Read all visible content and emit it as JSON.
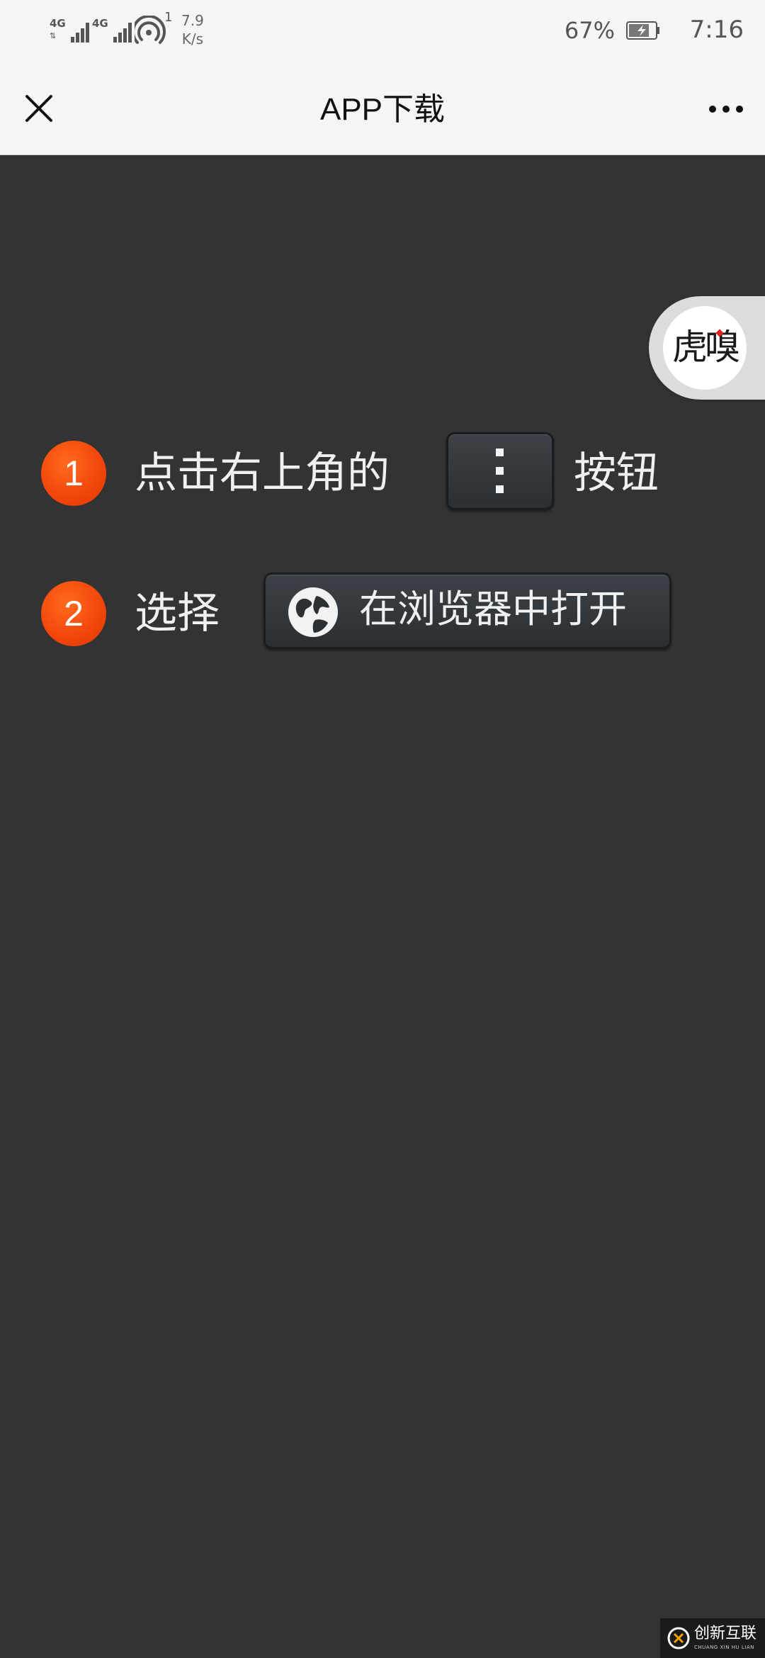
{
  "status_bar": {
    "network_1": "4G",
    "network_2": "4G",
    "hotspot_count": "1",
    "speed_value": "7.9",
    "speed_unit": "K/s",
    "battery_percent": "67%",
    "time": "7:16",
    "icons": [
      "signal-icon",
      "signal-icon",
      "hotspot-icon",
      "battery-charging-icon"
    ]
  },
  "nav": {
    "title": "APP下载",
    "close_icon": "close-icon",
    "more_icon": "more-dots-icon"
  },
  "logo": {
    "text": "虎嗅"
  },
  "steps": [
    {
      "number": "1",
      "text_before": "点击右上角的",
      "button_icon": "vertical-dots-icon",
      "text_after": "按钮"
    },
    {
      "number": "2",
      "text_before": "选择",
      "button_icon": "globe-icon",
      "button_label": "在浏览器中打开"
    }
  ],
  "watermark": {
    "title": "创新互联",
    "subtitle": "CHUANG XIN HU LIAN"
  },
  "colors": {
    "background": "#333333",
    "bar_background": "#f5f5f5",
    "step_badge": "#f2450a"
  }
}
